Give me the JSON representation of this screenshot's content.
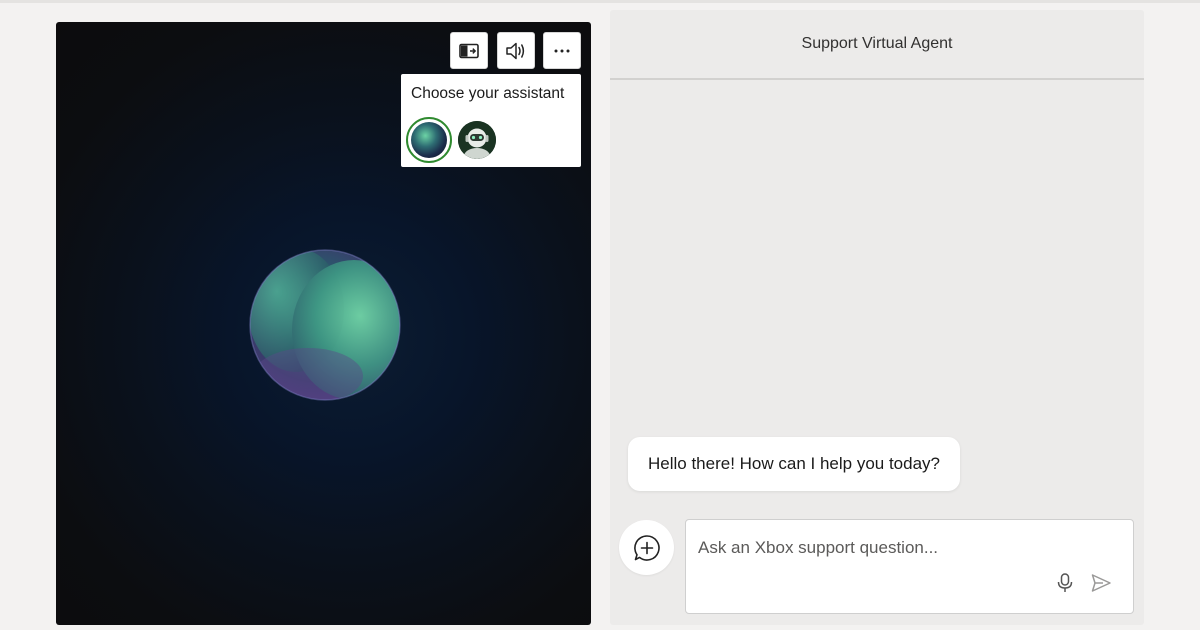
{
  "visual": {
    "assistant_picker": {
      "title": "Choose your assistant",
      "options": [
        {
          "name": "orb",
          "selected": true
        },
        {
          "name": "robot",
          "selected": false
        }
      ]
    },
    "controls": [
      "layout-icon",
      "speaker-icon",
      "more-icon"
    ]
  },
  "chat": {
    "title": "Support Virtual Agent",
    "messages": [
      {
        "sender": "agent",
        "text": "Hello there! How can I help you today?"
      }
    ],
    "input": {
      "placeholder": "Ask an Xbox support question...",
      "value": ""
    }
  },
  "colors": {
    "page_bg": "#f3f2f1",
    "panel_bg": "#ecebea",
    "selected_ring": "#2f8a2f",
    "visual_bg": "#0c0d10"
  }
}
